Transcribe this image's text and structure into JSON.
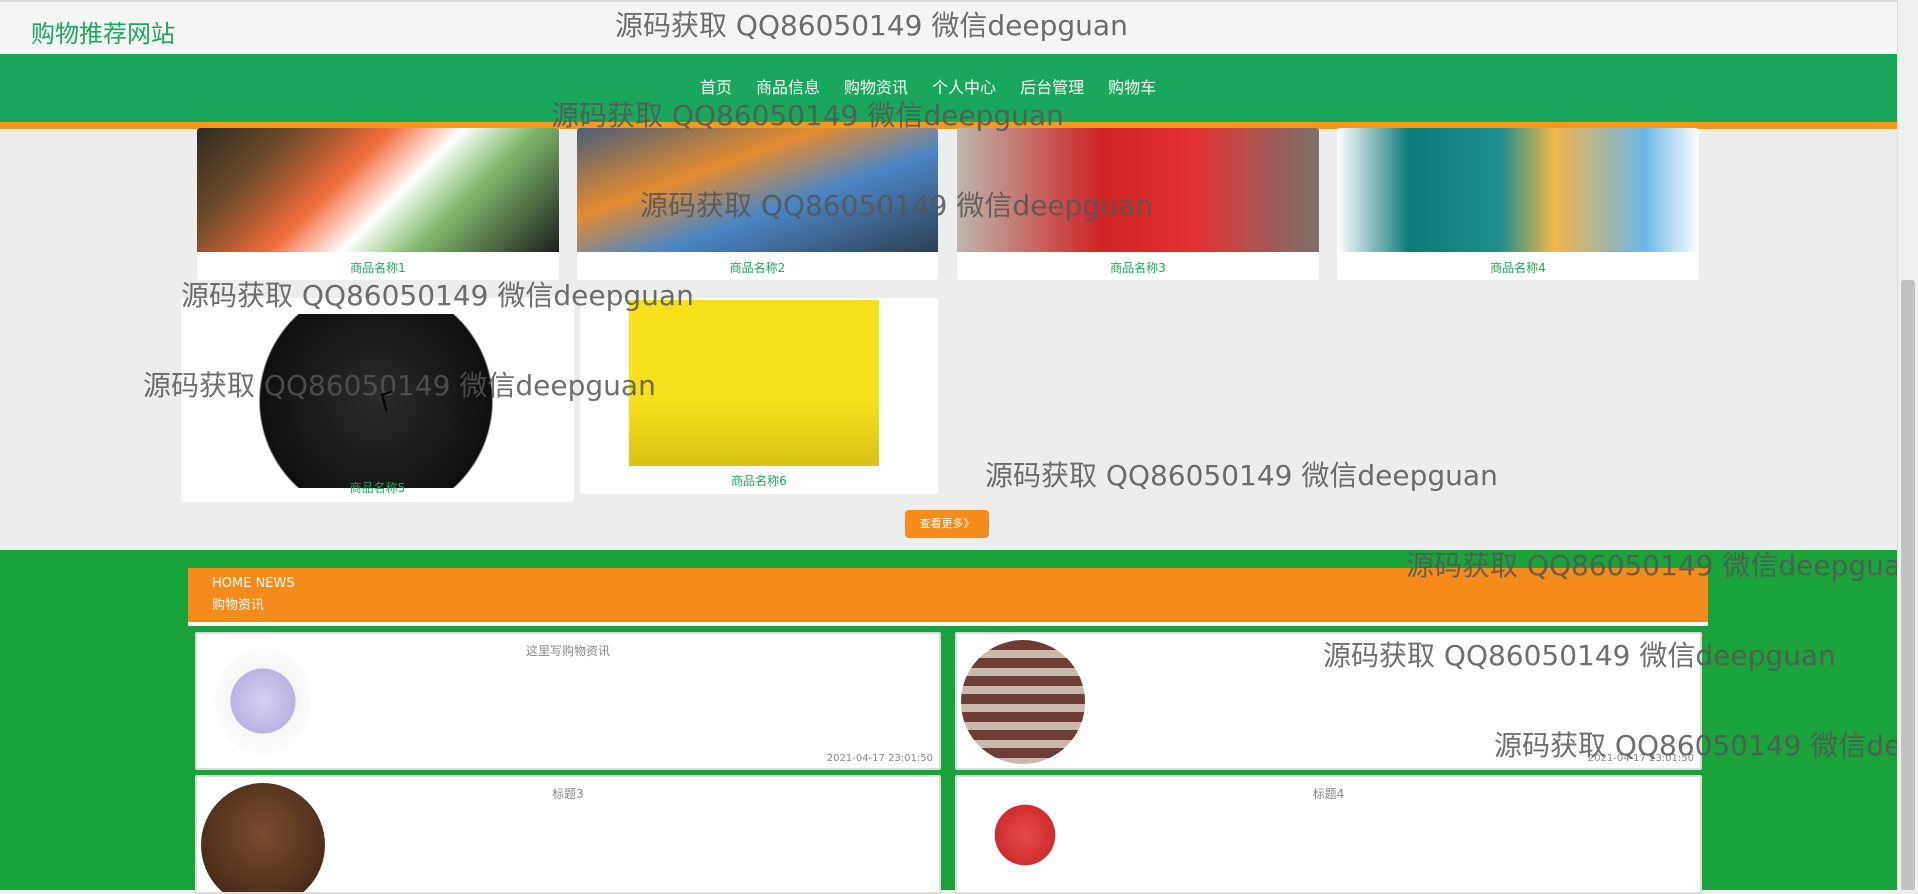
{
  "site": {
    "title": "购物推荐网站"
  },
  "nav": {
    "items": [
      "首页",
      "商品信息",
      "购物资讯",
      "个人中心",
      "后台管理",
      "购物车"
    ]
  },
  "products": [
    {
      "name": "商品名称1"
    },
    {
      "name": "商品名称2"
    },
    {
      "name": "商品名称3"
    },
    {
      "name": "商品名称4"
    },
    {
      "name": "商品名称5"
    },
    {
      "name": "商品名称6"
    }
  ],
  "view_more": "查看更多》",
  "news": {
    "header_en": "HOME NEWS",
    "header_cn": "购物资讯",
    "items": [
      {
        "title": "这里写购物资讯",
        "date": "2021-04-17 23:01:50"
      },
      {
        "title": "",
        "date": "2021-04-17 23:01:50"
      },
      {
        "title": "标题3",
        "date": ""
      },
      {
        "title": "标题4",
        "date": ""
      }
    ]
  },
  "watermark": "源码获取 QQ86050149 微信deepguan",
  "colors": {
    "green": "#19a85b",
    "orange": "#f58b1a",
    "news_green": "#1aa33a"
  }
}
